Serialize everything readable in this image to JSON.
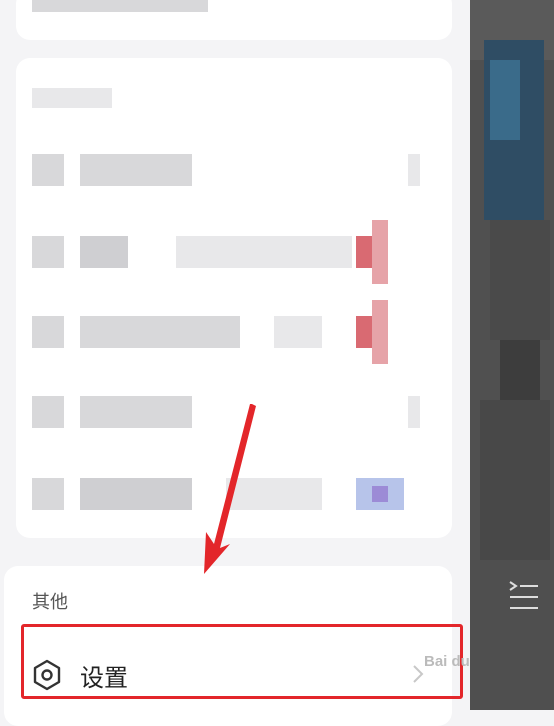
{
  "section": {
    "title": "其他"
  },
  "settings": {
    "label": "设置",
    "icon": "hexagon-settings-icon"
  },
  "watermark": {
    "text": "Bai du 经验"
  },
  "colors": {
    "annotation_red": "#e3262a",
    "text_primary": "#222222",
    "text_secondary": "#555555"
  }
}
